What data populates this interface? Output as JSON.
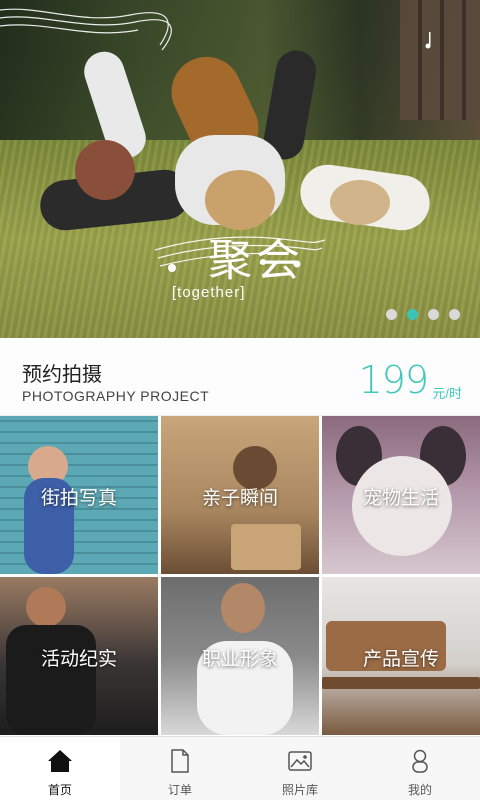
{
  "banner": {
    "logo_cn": "聚会",
    "logo_en": "[together]",
    "slides": 4,
    "active_slide": 1
  },
  "promo": {
    "title": "预约拍摄",
    "subtitle": "PHOTOGRAPHY PROJECT",
    "price": "199",
    "unit": "元/时"
  },
  "categories": [
    {
      "label": "街拍写真"
    },
    {
      "label": "亲子瞬间"
    },
    {
      "label": "宠物生活"
    },
    {
      "label": "活动纪实"
    },
    {
      "label": "职业形象"
    },
    {
      "label": "产品宣传"
    }
  ],
  "nav": {
    "items": [
      {
        "label": "首页",
        "icon": "home-icon",
        "active": true
      },
      {
        "label": "订单",
        "icon": "document-icon",
        "active": false
      },
      {
        "label": "照片库",
        "icon": "image-icon",
        "active": false
      },
      {
        "label": "我的",
        "icon": "user-icon",
        "active": false
      }
    ]
  },
  "colors": {
    "accent": "#3cc3b8",
    "dot_inactive": "#d9d9d9"
  }
}
